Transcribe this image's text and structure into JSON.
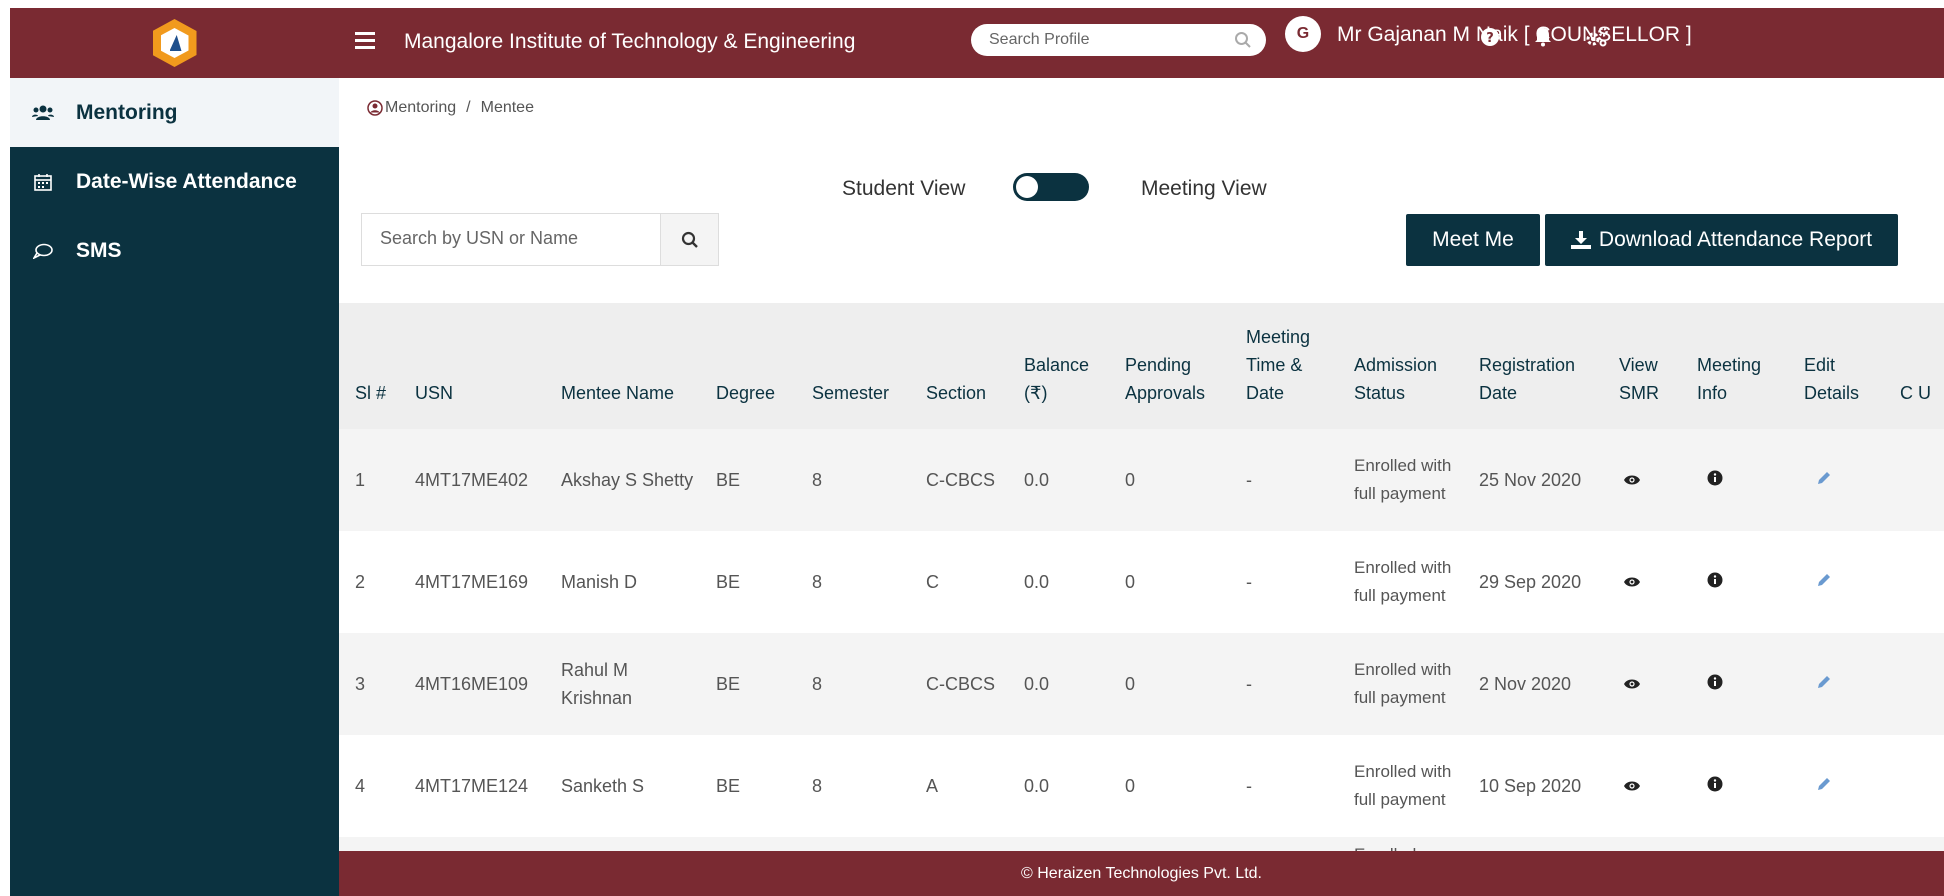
{
  "header": {
    "title": "Mangalore Institute of Technology & Engineering",
    "search_placeholder": "Search Profile",
    "avatar_letter": "G",
    "user_label": "Mr Gajanan M Naik [ COUNSELLOR ]",
    "brand_color": "#7a2a32"
  },
  "sidebar": {
    "color": "#0b3240",
    "items": [
      {
        "label": "Mentoring",
        "icon": "users-icon",
        "active": true
      },
      {
        "label": "Date-Wise Attendance",
        "icon": "calendar-icon",
        "active": false
      },
      {
        "label": "SMS",
        "icon": "chat-icon",
        "active": false
      }
    ]
  },
  "breadcrumb": {
    "root": "Mentoring",
    "separator": "/",
    "current": "Mentee"
  },
  "view_toggle": {
    "left_label": "Student View",
    "right_label": "Meeting View"
  },
  "search": {
    "placeholder": "Search by USN or Name"
  },
  "actions": {
    "meet_me": "Meet Me",
    "download": "Download Attendance Report"
  },
  "table": {
    "headers": {
      "sl": "Sl #",
      "usn": "USN",
      "name": "Mentee Name",
      "degree": "Degree",
      "semester": "Semester",
      "section": "Section",
      "balance": "Balance (₹)",
      "pending": "Pending Approvals",
      "meeting_time": "Meeting Time & Date",
      "admission": "Admission Status",
      "registration": "Registration Date",
      "view_smr": "View SMR",
      "meeting_info": "Meeting Info",
      "edit": "Edit Details",
      "extra": "C U"
    },
    "rows": [
      {
        "sl": "1",
        "usn": "4MT17ME402",
        "name": "Akshay S Shetty",
        "degree": "BE",
        "semester": "8",
        "section": "C-CBCS",
        "balance": "0.0",
        "pending": "0",
        "meeting": "-",
        "admission": "Enrolled with full payment",
        "registration": "25 Nov 2020"
      },
      {
        "sl": "2",
        "usn": "4MT17ME169",
        "name": "Manish D",
        "degree": "BE",
        "semester": "8",
        "section": "C",
        "balance": "0.0",
        "pending": "0",
        "meeting": "-",
        "admission": "Enrolled with full payment",
        "registration": "29 Sep 2020"
      },
      {
        "sl": "3",
        "usn": "4MT16ME109",
        "name": "Rahul M Krishnan",
        "degree": "BE",
        "semester": "8",
        "section": "C-CBCS",
        "balance": "0.0",
        "pending": "0",
        "meeting": "-",
        "admission": "Enrolled with full payment",
        "registration": "2 Nov 2020"
      },
      {
        "sl": "4",
        "usn": "4MT17ME124",
        "name": "Sanketh S",
        "degree": "BE",
        "semester": "8",
        "section": "A",
        "balance": "0.0",
        "pending": "0",
        "meeting": "-",
        "admission": "Enrolled with full payment",
        "registration": "10 Sep 2020"
      },
      {
        "sl": "",
        "usn": "",
        "name": "",
        "degree": "",
        "semester": "",
        "section": "",
        "balance": "",
        "pending": "",
        "meeting": "",
        "admission": "Enrolled",
        "registration": ""
      }
    ]
  },
  "footer": {
    "text": "© Heraizen Technologies Pvt. Ltd."
  }
}
